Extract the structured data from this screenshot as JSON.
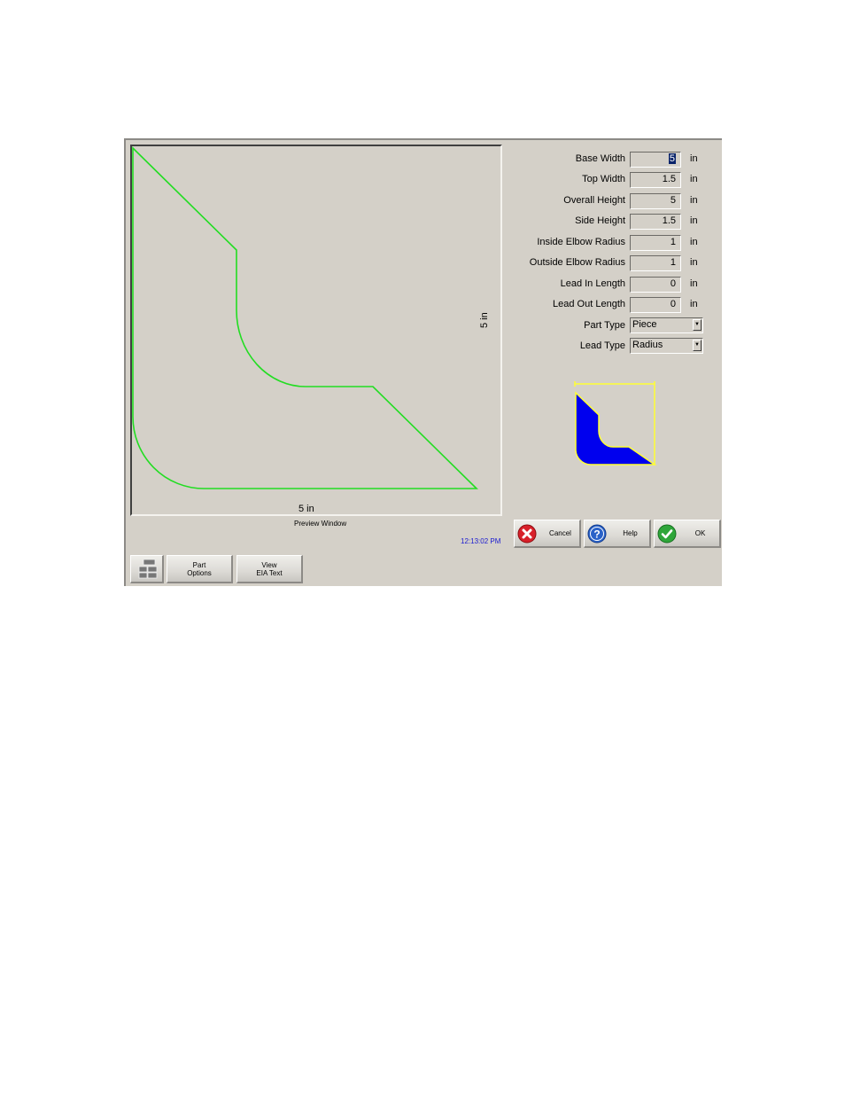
{
  "preview": {
    "caption": "Preview Window",
    "dimension_bottom": "5 in",
    "dimension_right": "5 in",
    "outline_color": "#22dd22",
    "shape_params_in": {
      "base_width": 5,
      "top_width": 1.5,
      "overall_height": 5,
      "side_height": 1.5,
      "inside_elbow_radius": 1,
      "outside_elbow_radius": 1
    }
  },
  "clock": "12:13:02 PM",
  "fields": [
    {
      "label": "Base Width",
      "value": "5",
      "unit": "in",
      "selected": true
    },
    {
      "label": "Top Width",
      "value": "1.5",
      "unit": "in"
    },
    {
      "label": "Overall Height",
      "value": "5",
      "unit": "in"
    },
    {
      "label": "Side Height",
      "value": "1.5",
      "unit": "in"
    },
    {
      "label": "Inside Elbow Radius",
      "value": "1",
      "unit": "in"
    },
    {
      "label": "Outside Elbow Radius",
      "value": "1",
      "unit": "in"
    },
    {
      "label": "Lead In Length",
      "value": "0",
      "unit": "in"
    },
    {
      "label": "Lead Out Length",
      "value": "0",
      "unit": "in"
    }
  ],
  "dropdowns": [
    {
      "label": "Part Type",
      "value": "Piece"
    },
    {
      "label": "Lead Type",
      "value": "Radius"
    }
  ],
  "thumbnail": {
    "fill_color": "#0000ee",
    "outline_color": "#ffff33"
  },
  "buttons": {
    "cancel": "Cancel",
    "help": "Help",
    "ok": "OK",
    "part_options_line1": "Part",
    "part_options_line2": "Options",
    "view_eia_line1": "View",
    "view_eia_line2": "EIA Text"
  },
  "icons": {
    "cancel": "x-circle-icon",
    "help": "question-circle-icon",
    "ok": "checkmark-circle-icon",
    "keyboard": "keyboard-icon"
  }
}
